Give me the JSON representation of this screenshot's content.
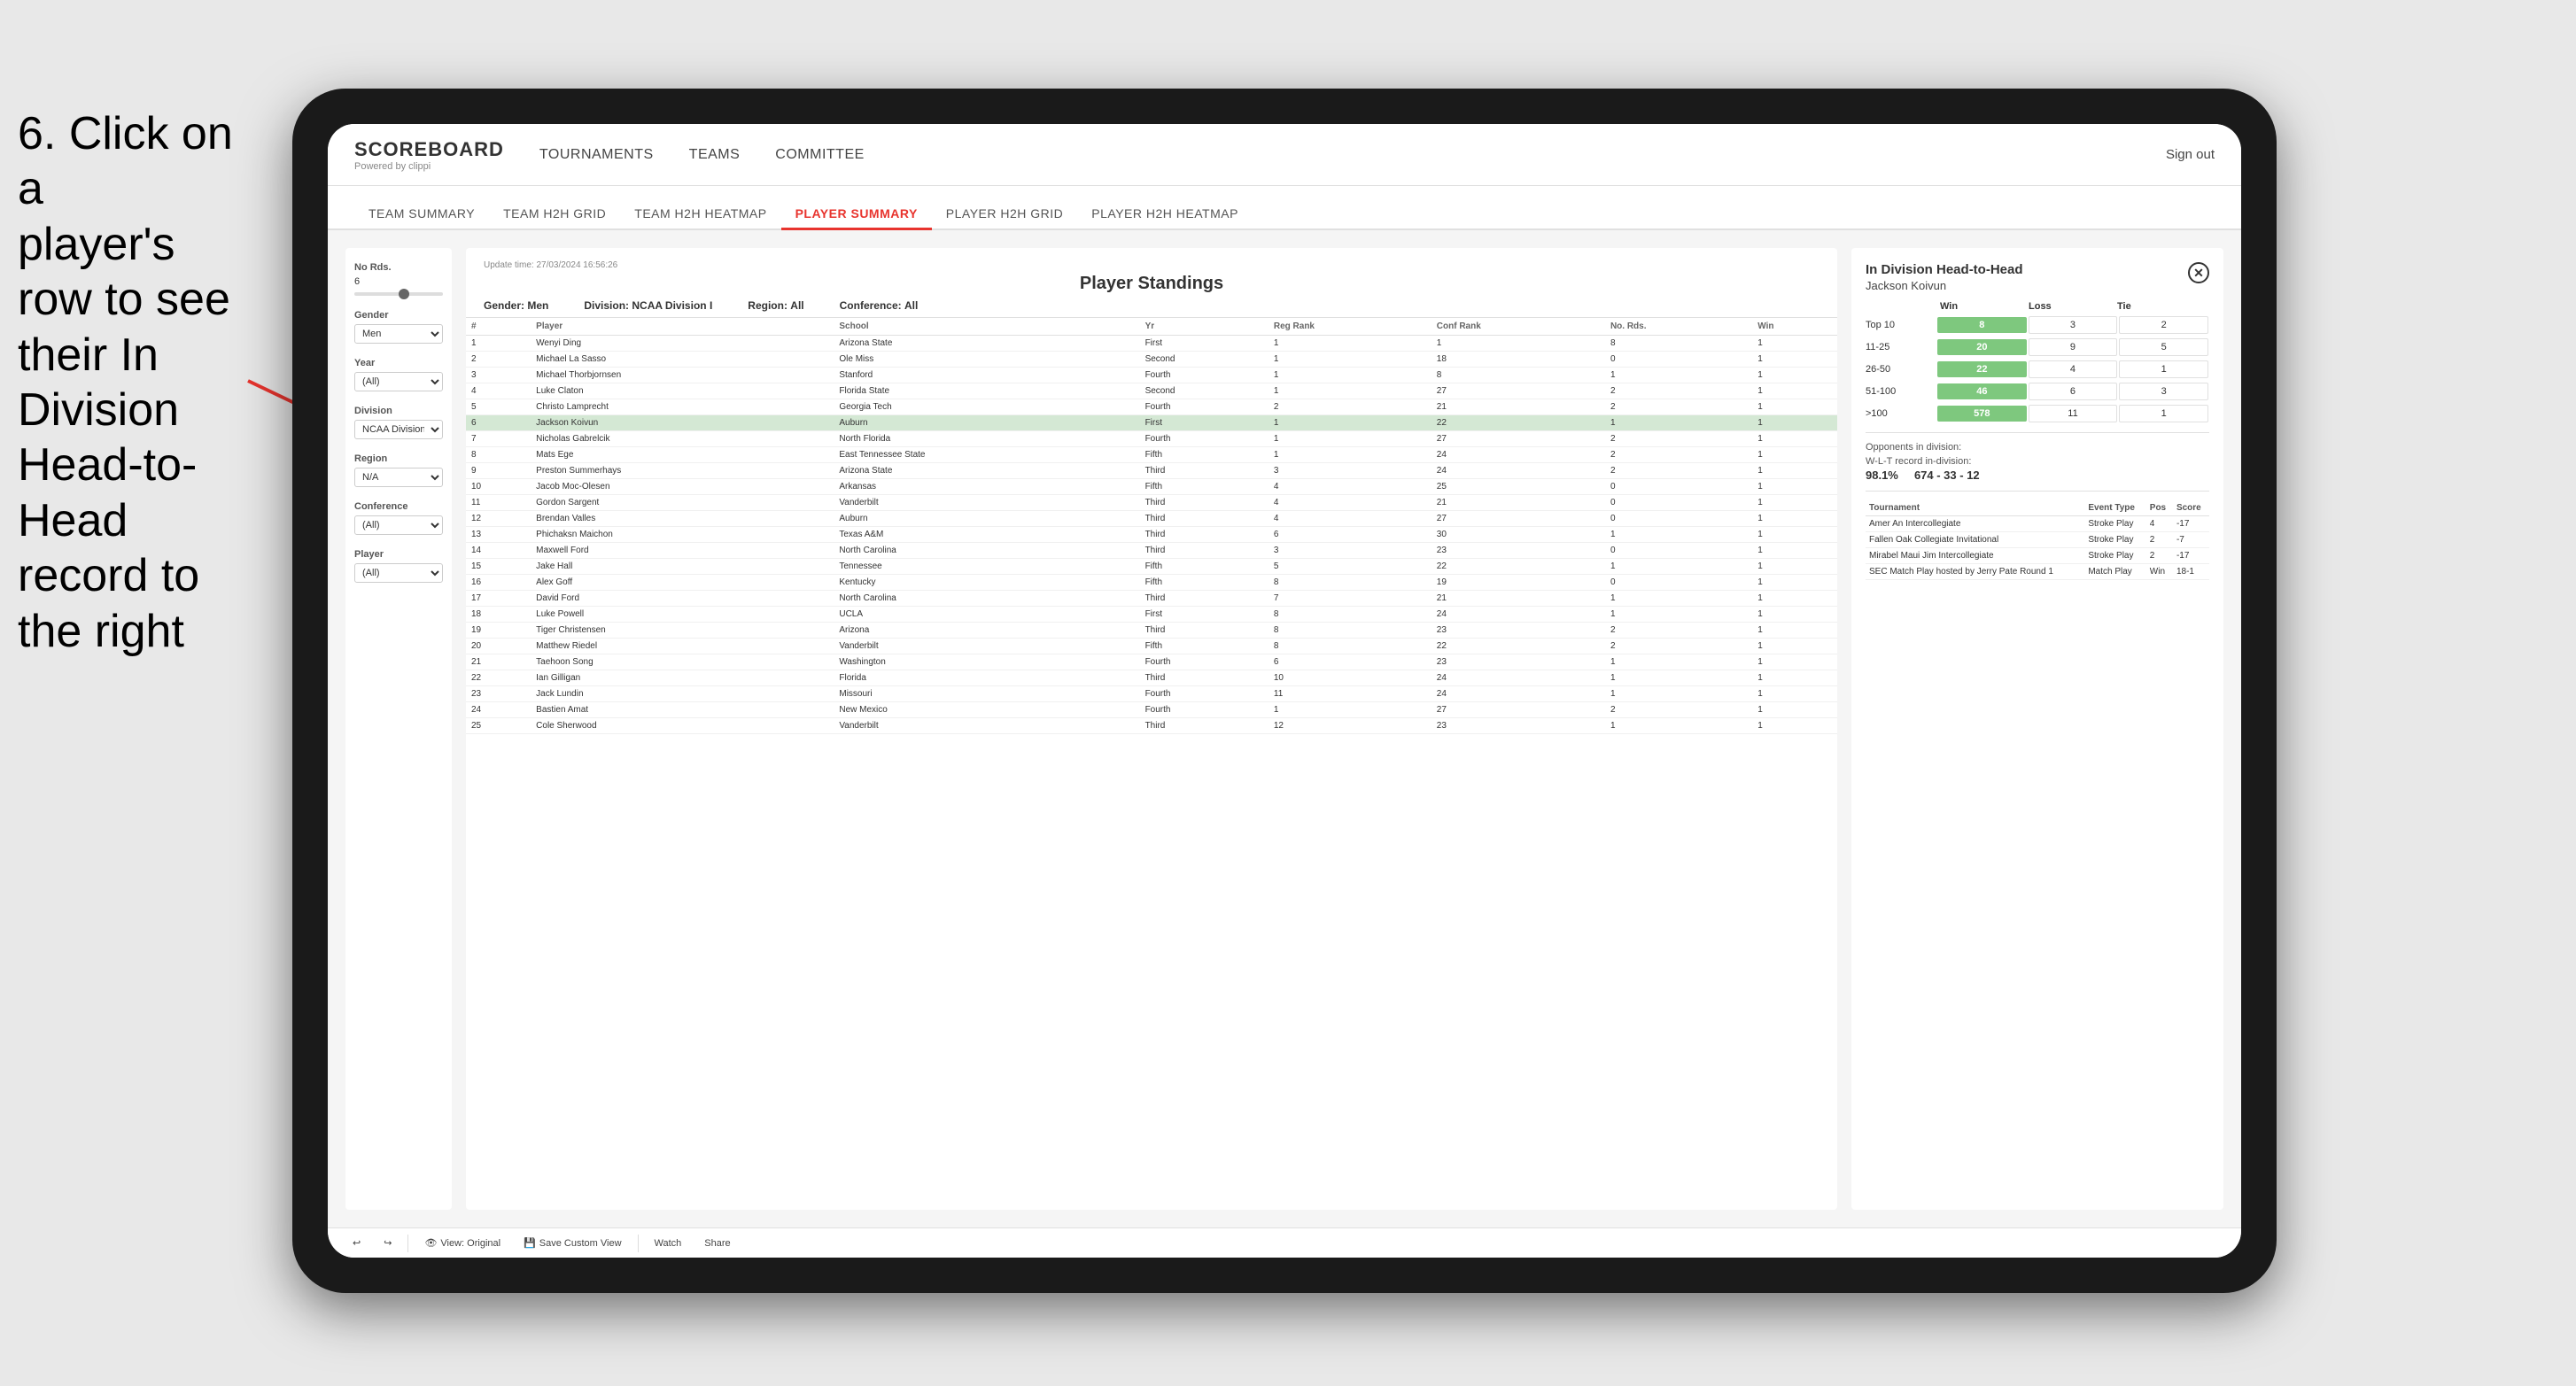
{
  "instruction": {
    "line1": "6. Click on a",
    "line2": "player's row to see",
    "line3": "their In Division",
    "line4": "Head-to-Head",
    "line5": "record to the right"
  },
  "nav": {
    "logo_title": "SCOREBOARD",
    "logo_subtitle": "Powered by clippi",
    "items": [
      "TOURNAMENTS",
      "TEAMS",
      "COMMITTEE"
    ],
    "sign_out": "Sign out"
  },
  "subnav": {
    "items": [
      "TEAM SUMMARY",
      "TEAM H2H GRID",
      "TEAM H2H HEATMAP",
      "PLAYER SUMMARY",
      "PLAYER H2H GRID",
      "PLAYER H2H HEATMAP"
    ],
    "active": "PLAYER SUMMARY"
  },
  "filters": {
    "no_rds_label": "No Rds.",
    "no_rds_value": "6",
    "gender_label": "Gender",
    "gender_value": "Men",
    "year_label": "Year",
    "year_value": "(All)",
    "division_label": "Division",
    "division_value": "NCAA Division I",
    "region_label": "Region",
    "region_value": "N/A",
    "conference_label": "Conference",
    "conference_value": "(All)",
    "player_label": "Player",
    "player_value": "(All)"
  },
  "standings": {
    "update_time": "Update time: 27/03/2024 16:56:26",
    "title": "Player Standings",
    "gender_label": "Gender:",
    "gender_value": "Men",
    "division_label": "Division:",
    "division_value": "NCAA Division I",
    "region_label": "Region:",
    "region_value": "All",
    "conference_label": "Conference:",
    "conference_value": "All",
    "columns": [
      "#",
      "Player",
      "School",
      "Yr",
      "Reg Rank",
      "Conf Rank",
      "No. Rds.",
      "Win"
    ],
    "rows": [
      {
        "num": "1",
        "player": "Wenyi Ding",
        "school": "Arizona State",
        "yr": "First",
        "reg": "1",
        "conf": "1",
        "rds": "8",
        "win": "1"
      },
      {
        "num": "2",
        "player": "Michael La Sasso",
        "school": "Ole Miss",
        "yr": "Second",
        "reg": "1",
        "conf": "18",
        "rds": "0",
        "win": "1"
      },
      {
        "num": "3",
        "player": "Michael Thorbjornsen",
        "school": "Stanford",
        "yr": "Fourth",
        "reg": "1",
        "conf": "8",
        "rds": "1",
        "win": "1"
      },
      {
        "num": "4",
        "player": "Luke Claton",
        "school": "Florida State",
        "yr": "Second",
        "reg": "1",
        "conf": "27",
        "rds": "2",
        "win": "1"
      },
      {
        "num": "5",
        "player": "Christo Lamprecht",
        "school": "Georgia Tech",
        "yr": "Fourth",
        "reg": "2",
        "conf": "21",
        "rds": "2",
        "win": "1"
      },
      {
        "num": "6",
        "player": "Jackson Koivun",
        "school": "Auburn",
        "yr": "First",
        "reg": "1",
        "conf": "22",
        "rds": "1",
        "win": "1",
        "selected": true
      },
      {
        "num": "7",
        "player": "Nicholas Gabrelcik",
        "school": "North Florida",
        "yr": "Fourth",
        "reg": "1",
        "conf": "27",
        "rds": "2",
        "win": "1"
      },
      {
        "num": "8",
        "player": "Mats Ege",
        "school": "East Tennessee State",
        "yr": "Fifth",
        "reg": "1",
        "conf": "24",
        "rds": "2",
        "win": "1"
      },
      {
        "num": "9",
        "player": "Preston Summerhays",
        "school": "Arizona State",
        "yr": "Third",
        "reg": "3",
        "conf": "24",
        "rds": "2",
        "win": "1"
      },
      {
        "num": "10",
        "player": "Jacob Moc-Olesen",
        "school": "Arkansas",
        "yr": "Fifth",
        "reg": "4",
        "conf": "25",
        "rds": "0",
        "win": "1"
      },
      {
        "num": "11",
        "player": "Gordon Sargent",
        "school": "Vanderbilt",
        "yr": "Third",
        "reg": "4",
        "conf": "21",
        "rds": "0",
        "win": "1"
      },
      {
        "num": "12",
        "player": "Brendan Valles",
        "school": "Auburn",
        "yr": "Third",
        "reg": "4",
        "conf": "27",
        "rds": "0",
        "win": "1"
      },
      {
        "num": "13",
        "player": "Phichaksn Maichon",
        "school": "Texas A&M",
        "yr": "Third",
        "reg": "6",
        "conf": "30",
        "rds": "1",
        "win": "1"
      },
      {
        "num": "14",
        "player": "Maxwell Ford",
        "school": "North Carolina",
        "yr": "Third",
        "reg": "3",
        "conf": "23",
        "rds": "0",
        "win": "1"
      },
      {
        "num": "15",
        "player": "Jake Hall",
        "school": "Tennessee",
        "yr": "Fifth",
        "reg": "5",
        "conf": "22",
        "rds": "1",
        "win": "1"
      },
      {
        "num": "16",
        "player": "Alex Goff",
        "school": "Kentucky",
        "yr": "Fifth",
        "reg": "8",
        "conf": "19",
        "rds": "0",
        "win": "1"
      },
      {
        "num": "17",
        "player": "David Ford",
        "school": "North Carolina",
        "yr": "Third",
        "reg": "7",
        "conf": "21",
        "rds": "1",
        "win": "1"
      },
      {
        "num": "18",
        "player": "Luke Powell",
        "school": "UCLA",
        "yr": "First",
        "reg": "8",
        "conf": "24",
        "rds": "1",
        "win": "1"
      },
      {
        "num": "19",
        "player": "Tiger Christensen",
        "school": "Arizona",
        "yr": "Third",
        "reg": "8",
        "conf": "23",
        "rds": "2",
        "win": "1"
      },
      {
        "num": "20",
        "player": "Matthew Riedel",
        "school": "Vanderbilt",
        "yr": "Fifth",
        "reg": "8",
        "conf": "22",
        "rds": "2",
        "win": "1"
      },
      {
        "num": "21",
        "player": "Taehoon Song",
        "school": "Washington",
        "yr": "Fourth",
        "reg": "6",
        "conf": "23",
        "rds": "1",
        "win": "1"
      },
      {
        "num": "22",
        "player": "Ian Gilligan",
        "school": "Florida",
        "yr": "Third",
        "reg": "10",
        "conf": "24",
        "rds": "1",
        "win": "1"
      },
      {
        "num": "23",
        "player": "Jack Lundin",
        "school": "Missouri",
        "yr": "Fourth",
        "reg": "11",
        "conf": "24",
        "rds": "1",
        "win": "1"
      },
      {
        "num": "24",
        "player": "Bastien Amat",
        "school": "New Mexico",
        "yr": "Fourth",
        "reg": "1",
        "conf": "27",
        "rds": "2",
        "win": "1"
      },
      {
        "num": "25",
        "player": "Cole Sherwood",
        "school": "Vanderbilt",
        "yr": "Third",
        "reg": "12",
        "conf": "23",
        "rds": "1",
        "win": "1"
      }
    ]
  },
  "h2h": {
    "title": "In Division Head-to-Head",
    "player": "Jackson Koivun",
    "columns": [
      "Win",
      "Loss",
      "Tie"
    ],
    "rows": [
      {
        "label": "Top 10",
        "win": "8",
        "loss": "3",
        "tie": "2",
        "win_green": true
      },
      {
        "label": "11-25",
        "win": "20",
        "loss": "9",
        "tie": "5",
        "win_green": true
      },
      {
        "label": "26-50",
        "win": "22",
        "loss": "4",
        "tie": "1",
        "win_green": true
      },
      {
        "label": "51-100",
        "win": "46",
        "loss": "6",
        "tie": "3",
        "win_green": true
      },
      {
        "label": ">100",
        "win": "578",
        "loss": "11",
        "tie": "1",
        "win_green": true
      }
    ],
    "opponents_label": "Opponents in division:",
    "wl_record": "W-L-T record in-division:",
    "wl_value": "674 - 33 - 12",
    "percentage": "98.1%",
    "tournament_columns": [
      "Tournament",
      "Event Type",
      "Pos",
      "Score"
    ],
    "tournaments": [
      {
        "name": "Amer An Intercollegiate",
        "type": "Stroke Play",
        "pos": "4",
        "score": "-17"
      },
      {
        "name": "Fallen Oak Collegiate Invitational",
        "type": "Stroke Play",
        "pos": "2",
        "score": "-7"
      },
      {
        "name": "Mirabel Maui Jim Intercollegiate",
        "type": "Stroke Play",
        "pos": "2",
        "score": "-17"
      },
      {
        "name": "SEC Match Play hosted by Jerry Pate Round 1",
        "type": "Match Play",
        "pos": "Win",
        "score": "18-1"
      }
    ]
  },
  "toolbar": {
    "view_original": "View: Original",
    "save_custom": "Save Custom View",
    "watch": "Watch",
    "share": "Share"
  }
}
